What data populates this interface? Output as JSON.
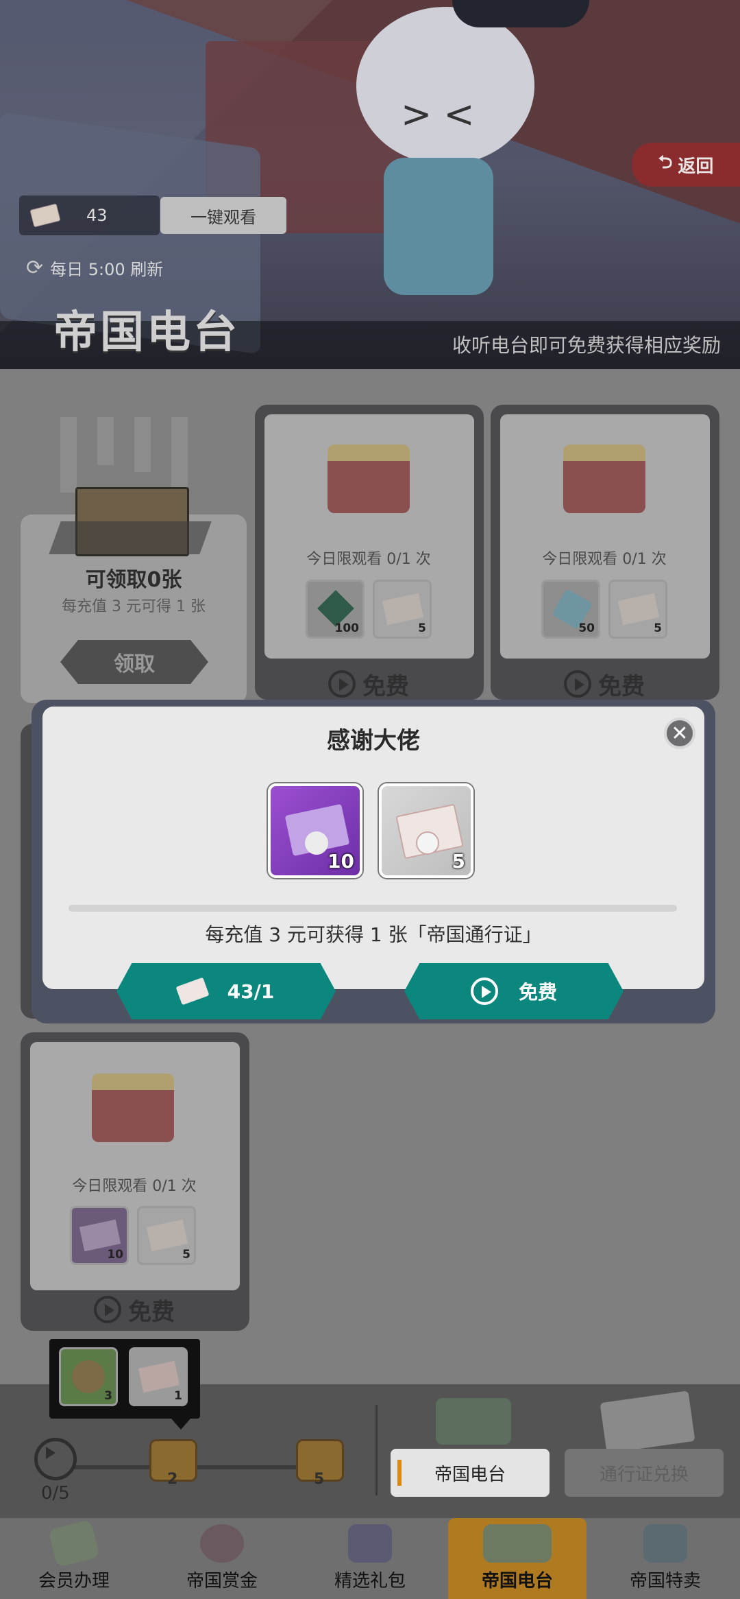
{
  "header": {
    "back_label": "返回",
    "ticket_count": "43",
    "watch_all_label": "一键观看",
    "refresh_text": "每日 5:00 刷新",
    "title": "帝国电台",
    "subtitle": "收听电台即可免费获得相应奖励"
  },
  "claim_card": {
    "title": "可领取0张",
    "desc": "每充值 3 元可得 1 张",
    "button": "领取"
  },
  "radio_cards": [
    {
      "limit": "今日限观看 0/1 次",
      "items": [
        {
          "icon": "green-gem-icon",
          "count": "100"
        },
        {
          "icon": "pass-ticket-icon",
          "count": "5"
        }
      ],
      "button": "免费"
    },
    {
      "limit": "今日限观看 0/1 次",
      "items": [
        {
          "icon": "blue-cube-icon",
          "count": "50"
        },
        {
          "icon": "pass-ticket-icon",
          "count": "5"
        }
      ],
      "button": "免费"
    },
    {
      "limit": "今日限观看 0/1 次",
      "items": [
        {
          "icon": "purple-ticket-icon",
          "count": "10"
        },
        {
          "icon": "pass-ticket-icon",
          "count": "5"
        }
      ],
      "button": "免费"
    }
  ],
  "modal": {
    "title": "感谢大佬",
    "rewards": [
      {
        "icon": "purple-ticket-icon",
        "count": "10"
      },
      {
        "icon": "pass-ticket-icon",
        "count": "5"
      }
    ],
    "note": "每充值 3 元可获得 1 张「帝国通行证」",
    "pay_button": "43/1",
    "free_button": "免费"
  },
  "progress": {
    "tooltip_items": [
      {
        "icon": "green-orb-icon",
        "count": "3"
      },
      {
        "icon": "pass-ticket-icon",
        "count": "1"
      }
    ],
    "count_text": "0/5",
    "milestones": [
      "2",
      "5"
    ],
    "side_tabs": [
      "帝国电台",
      "通行证兑换"
    ]
  },
  "bottom_tabs": [
    "会员办理",
    "帝国赏金",
    "精选礼包",
    "帝国电台",
    "帝国特卖"
  ],
  "colors": {
    "teal": "#0c877e",
    "active_tab": "#e8a02a",
    "back_red": "#8a2b2e"
  }
}
